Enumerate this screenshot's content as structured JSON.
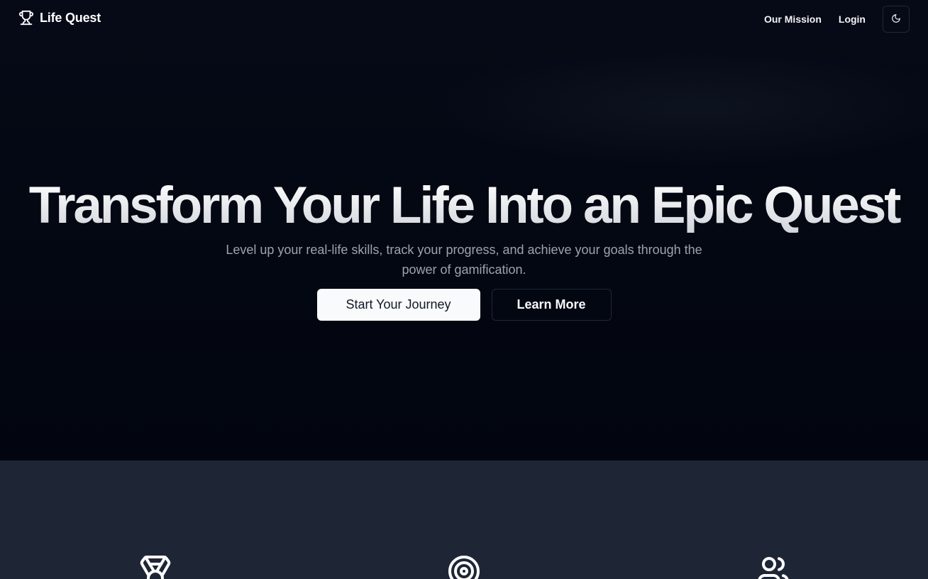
{
  "nav": {
    "brand": "Life Quest",
    "brand_icon": "trophy-icon",
    "links": [
      "Our Mission",
      "Login"
    ],
    "theme_toggle_icon": "moon-icon"
  },
  "hero": {
    "title": "Transform Your Life Into an Epic Quest",
    "subtitle": "Level up your real-life skills, track your progress, and achieve your goals through the power of gamification.",
    "primary_button": "Start Your Journey",
    "secondary_button": "Learn More"
  },
  "features": {
    "icons": [
      "medal-icon",
      "target-icon",
      "users-icon"
    ]
  },
  "colors": {
    "hero_background": "#030712",
    "features_background": "#1e2636",
    "primary_button_bg": "#f9fafb",
    "text_muted": "#9ca3af"
  }
}
